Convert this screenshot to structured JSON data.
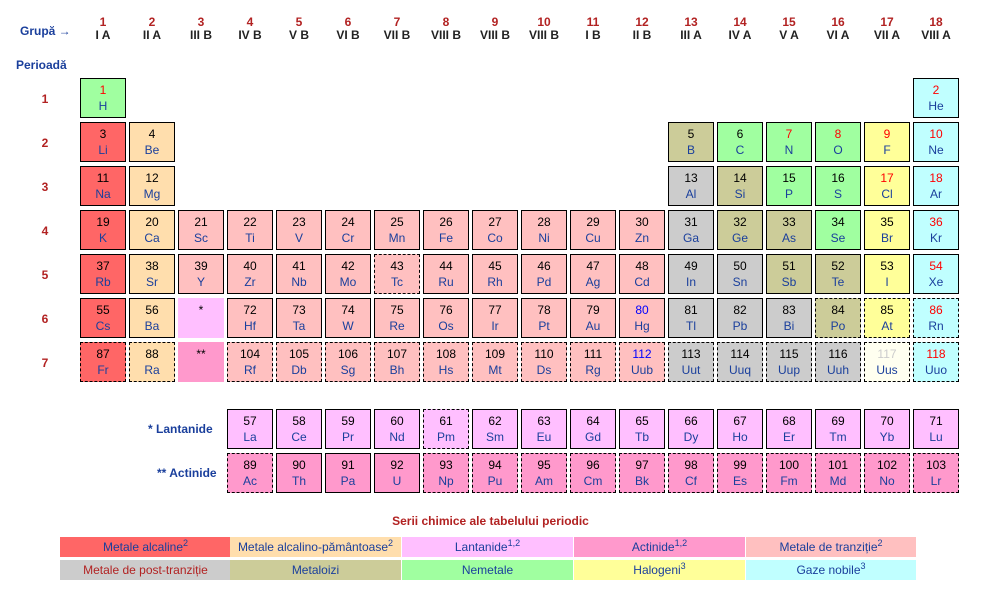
{
  "header": {
    "group_label": "Grupă →",
    "period_label": "Perioadă"
  },
  "groups": [
    {
      "n": "1",
      "r": "I A"
    },
    {
      "n": "2",
      "r": "II A"
    },
    {
      "n": "3",
      "r": "III B"
    },
    {
      "n": "4",
      "r": "IV B"
    },
    {
      "n": "5",
      "r": "V B"
    },
    {
      "n": "6",
      "r": "VI B"
    },
    {
      "n": "7",
      "r": "VII B"
    },
    {
      "n": "8",
      "r": "VIII B"
    },
    {
      "n": "9",
      "r": "VIII B"
    },
    {
      "n": "10",
      "r": "VIII B"
    },
    {
      "n": "11",
      "r": "I B"
    },
    {
      "n": "12",
      "r": "II B"
    },
    {
      "n": "13",
      "r": "III A"
    },
    {
      "n": "14",
      "r": "IV A"
    },
    {
      "n": "15",
      "r": "V A"
    },
    {
      "n": "16",
      "r": "VI A"
    },
    {
      "n": "17",
      "r": "VII A"
    },
    {
      "n": "18",
      "r": "VIII A"
    }
  ],
  "periods": [
    "1",
    "2",
    "3",
    "4",
    "5",
    "6",
    "7"
  ],
  "series_labels": {
    "lanthanides": "* Lantanide",
    "actinides": "** Actinide"
  },
  "colors": {
    "alkali": "#ff6666",
    "alkaline": "#ffdead",
    "lanth": "#ffbfff",
    "actin": "#ff99cc",
    "trans": "#ffc0c0",
    "post": "#cccccc",
    "metalloid": "#cccc99",
    "nonmetal": "#a0ffa0",
    "halogen": "#ffff99",
    "noble": "#c0ffff",
    "unk": "#fffff0",
    "num_red": "#ff0000",
    "num_black": "#000000",
    "num_blue": "#0000ff",
    "num_grey": "#cccccc",
    "sym_blue": "#1a3f9c"
  },
  "elements": [
    {
      "z": "1",
      "s": "H",
      "g": 1,
      "p": 1,
      "c": "nonmetal",
      "n": "red"
    },
    {
      "z": "2",
      "s": "He",
      "g": 18,
      "p": 1,
      "c": "noble",
      "n": "red"
    },
    {
      "z": "3",
      "s": "Li",
      "g": 1,
      "p": 2,
      "c": "alkali",
      "n": "black"
    },
    {
      "z": "4",
      "s": "Be",
      "g": 2,
      "p": 2,
      "c": "alkaline",
      "n": "black"
    },
    {
      "z": "5",
      "s": "B",
      "g": 13,
      "p": 2,
      "c": "metalloid",
      "n": "black"
    },
    {
      "z": "6",
      "s": "C",
      "g": 14,
      "p": 2,
      "c": "nonmetal",
      "n": "black"
    },
    {
      "z": "7",
      "s": "N",
      "g": 15,
      "p": 2,
      "c": "nonmetal",
      "n": "red"
    },
    {
      "z": "8",
      "s": "O",
      "g": 16,
      "p": 2,
      "c": "nonmetal",
      "n": "red"
    },
    {
      "z": "9",
      "s": "F",
      "g": 17,
      "p": 2,
      "c": "halogen",
      "n": "red"
    },
    {
      "z": "10",
      "s": "Ne",
      "g": 18,
      "p": 2,
      "c": "noble",
      "n": "red"
    },
    {
      "z": "11",
      "s": "Na",
      "g": 1,
      "p": 3,
      "c": "alkali",
      "n": "black"
    },
    {
      "z": "12",
      "s": "Mg",
      "g": 2,
      "p": 3,
      "c": "alkaline",
      "n": "black"
    },
    {
      "z": "13",
      "s": "Al",
      "g": 13,
      "p": 3,
      "c": "post",
      "n": "black"
    },
    {
      "z": "14",
      "s": "Si",
      "g": 14,
      "p": 3,
      "c": "metalloid",
      "n": "black"
    },
    {
      "z": "15",
      "s": "P",
      "g": 15,
      "p": 3,
      "c": "nonmetal",
      "n": "black"
    },
    {
      "z": "16",
      "s": "S",
      "g": 16,
      "p": 3,
      "c": "nonmetal",
      "n": "black"
    },
    {
      "z": "17",
      "s": "Cl",
      "g": 17,
      "p": 3,
      "c": "halogen",
      "n": "red"
    },
    {
      "z": "18",
      "s": "Ar",
      "g": 18,
      "p": 3,
      "c": "noble",
      "n": "red"
    },
    {
      "z": "19",
      "s": "K",
      "g": 1,
      "p": 4,
      "c": "alkali",
      "n": "black"
    },
    {
      "z": "20",
      "s": "Ca",
      "g": 2,
      "p": 4,
      "c": "alkaline",
      "n": "black"
    },
    {
      "z": "21",
      "s": "Sc",
      "g": 3,
      "p": 4,
      "c": "trans",
      "n": "black"
    },
    {
      "z": "22",
      "s": "Ti",
      "g": 4,
      "p": 4,
      "c": "trans",
      "n": "black"
    },
    {
      "z": "23",
      "s": "V",
      "g": 5,
      "p": 4,
      "c": "trans",
      "n": "black"
    },
    {
      "z": "24",
      "s": "Cr",
      "g": 6,
      "p": 4,
      "c": "trans",
      "n": "black"
    },
    {
      "z": "25",
      "s": "Mn",
      "g": 7,
      "p": 4,
      "c": "trans",
      "n": "black"
    },
    {
      "z": "26",
      "s": "Fe",
      "g": 8,
      "p": 4,
      "c": "trans",
      "n": "black"
    },
    {
      "z": "27",
      "s": "Co",
      "g": 9,
      "p": 4,
      "c": "trans",
      "n": "black"
    },
    {
      "z": "28",
      "s": "Ni",
      "g": 10,
      "p": 4,
      "c": "trans",
      "n": "black"
    },
    {
      "z": "29",
      "s": "Cu",
      "g": 11,
      "p": 4,
      "c": "trans",
      "n": "black"
    },
    {
      "z": "30",
      "s": "Zn",
      "g": 12,
      "p": 4,
      "c": "trans",
      "n": "black"
    },
    {
      "z": "31",
      "s": "Ga",
      "g": 13,
      "p": 4,
      "c": "post",
      "n": "black"
    },
    {
      "z": "32",
      "s": "Ge",
      "g": 14,
      "p": 4,
      "c": "metalloid",
      "n": "black"
    },
    {
      "z": "33",
      "s": "As",
      "g": 15,
      "p": 4,
      "c": "metalloid",
      "n": "black"
    },
    {
      "z": "34",
      "s": "Se",
      "g": 16,
      "p": 4,
      "c": "nonmetal",
      "n": "black"
    },
    {
      "z": "35",
      "s": "Br",
      "g": 17,
      "p": 4,
      "c": "halogen",
      "n": "black"
    },
    {
      "z": "36",
      "s": "Kr",
      "g": 18,
      "p": 4,
      "c": "noble",
      "n": "red"
    },
    {
      "z": "37",
      "s": "Rb",
      "g": 1,
      "p": 5,
      "c": "alkali",
      "n": "black"
    },
    {
      "z": "38",
      "s": "Sr",
      "g": 2,
      "p": 5,
      "c": "alkaline",
      "n": "black"
    },
    {
      "z": "39",
      "s": "Y",
      "g": 3,
      "p": 5,
      "c": "trans",
      "n": "black"
    },
    {
      "z": "40",
      "s": "Zr",
      "g": 4,
      "p": 5,
      "c": "trans",
      "n": "black"
    },
    {
      "z": "41",
      "s": "Nb",
      "g": 5,
      "p": 5,
      "c": "trans",
      "n": "black"
    },
    {
      "z": "42",
      "s": "Mo",
      "g": 6,
      "p": 5,
      "c": "trans",
      "n": "black"
    },
    {
      "z": "43",
      "s": "Tc",
      "g": 7,
      "p": 5,
      "c": "trans",
      "n": "black",
      "d": 1
    },
    {
      "z": "44",
      "s": "Ru",
      "g": 8,
      "p": 5,
      "c": "trans",
      "n": "black"
    },
    {
      "z": "45",
      "s": "Rh",
      "g": 9,
      "p": 5,
      "c": "trans",
      "n": "black"
    },
    {
      "z": "46",
      "s": "Pd",
      "g": 10,
      "p": 5,
      "c": "trans",
      "n": "black"
    },
    {
      "z": "47",
      "s": "Ag",
      "g": 11,
      "p": 5,
      "c": "trans",
      "n": "black"
    },
    {
      "z": "48",
      "s": "Cd",
      "g": 12,
      "p": 5,
      "c": "trans",
      "n": "black"
    },
    {
      "z": "49",
      "s": "In",
      "g": 13,
      "p": 5,
      "c": "post",
      "n": "black"
    },
    {
      "z": "50",
      "s": "Sn",
      "g": 14,
      "p": 5,
      "c": "post",
      "n": "black"
    },
    {
      "z": "51",
      "s": "Sb",
      "g": 15,
      "p": 5,
      "c": "metalloid",
      "n": "black"
    },
    {
      "z": "52",
      "s": "Te",
      "g": 16,
      "p": 5,
      "c": "metalloid",
      "n": "black"
    },
    {
      "z": "53",
      "s": "I",
      "g": 17,
      "p": 5,
      "c": "halogen",
      "n": "black"
    },
    {
      "z": "54",
      "s": "Xe",
      "g": 18,
      "p": 5,
      "c": "noble",
      "n": "red"
    },
    {
      "z": "55",
      "s": "Cs",
      "g": 1,
      "p": 6,
      "c": "alkali",
      "n": "black"
    },
    {
      "z": "56",
      "s": "Ba",
      "g": 2,
      "p": 6,
      "c": "alkaline",
      "n": "black"
    },
    {
      "z": "*",
      "s": "",
      "g": 3,
      "p": 6,
      "c": "lanth",
      "n": "black",
      "m": 1
    },
    {
      "z": "72",
      "s": "Hf",
      "g": 4,
      "p": 6,
      "c": "trans",
      "n": "black"
    },
    {
      "z": "73",
      "s": "Ta",
      "g": 5,
      "p": 6,
      "c": "trans",
      "n": "black"
    },
    {
      "z": "74",
      "s": "W",
      "g": 6,
      "p": 6,
      "c": "trans",
      "n": "black"
    },
    {
      "z": "75",
      "s": "Re",
      "g": 7,
      "p": 6,
      "c": "trans",
      "n": "black"
    },
    {
      "z": "76",
      "s": "Os",
      "g": 8,
      "p": 6,
      "c": "trans",
      "n": "black"
    },
    {
      "z": "77",
      "s": "Ir",
      "g": 9,
      "p": 6,
      "c": "trans",
      "n": "black"
    },
    {
      "z": "78",
      "s": "Pt",
      "g": 10,
      "p": 6,
      "c": "trans",
      "n": "black"
    },
    {
      "z": "79",
      "s": "Au",
      "g": 11,
      "p": 6,
      "c": "trans",
      "n": "black"
    },
    {
      "z": "80",
      "s": "Hg",
      "g": 12,
      "p": 6,
      "c": "trans",
      "n": "blue"
    },
    {
      "z": "81",
      "s": "Tl",
      "g": 13,
      "p": 6,
      "c": "post",
      "n": "black"
    },
    {
      "z": "82",
      "s": "Pb",
      "g": 14,
      "p": 6,
      "c": "post",
      "n": "black"
    },
    {
      "z": "83",
      "s": "Bi",
      "g": 15,
      "p": 6,
      "c": "post",
      "n": "black"
    },
    {
      "z": "84",
      "s": "Po",
      "g": 16,
      "p": 6,
      "c": "metalloid",
      "n": "black",
      "d": 1
    },
    {
      "z": "85",
      "s": "At",
      "g": 17,
      "p": 6,
      "c": "halogen",
      "n": "black",
      "d": 1
    },
    {
      "z": "86",
      "s": "Rn",
      "g": 18,
      "p": 6,
      "c": "noble",
      "n": "red",
      "d": 1
    },
    {
      "z": "87",
      "s": "Fr",
      "g": 1,
      "p": 7,
      "c": "alkali",
      "n": "black",
      "d": 1
    },
    {
      "z": "88",
      "s": "Ra",
      "g": 2,
      "p": 7,
      "c": "alkaline",
      "n": "black",
      "d": 1
    },
    {
      "z": "**",
      "s": "",
      "g": 3,
      "p": 7,
      "c": "actin",
      "n": "black",
      "m": 1
    },
    {
      "z": "104",
      "s": "Rf",
      "g": 4,
      "p": 7,
      "c": "trans",
      "n": "black",
      "d": 1
    },
    {
      "z": "105",
      "s": "Db",
      "g": 5,
      "p": 7,
      "c": "trans",
      "n": "black",
      "d": 1
    },
    {
      "z": "106",
      "s": "Sg",
      "g": 6,
      "p": 7,
      "c": "trans",
      "n": "black",
      "d": 1
    },
    {
      "z": "107",
      "s": "Bh",
      "g": 7,
      "p": 7,
      "c": "trans",
      "n": "black",
      "d": 1
    },
    {
      "z": "108",
      "s": "Hs",
      "g": 8,
      "p": 7,
      "c": "trans",
      "n": "black",
      "d": 1
    },
    {
      "z": "109",
      "s": "Mt",
      "g": 9,
      "p": 7,
      "c": "trans",
      "n": "black",
      "d": 1
    },
    {
      "z": "110",
      "s": "Ds",
      "g": 10,
      "p": 7,
      "c": "trans",
      "n": "black",
      "d": 1
    },
    {
      "z": "111",
      "s": "Rg",
      "g": 11,
      "p": 7,
      "c": "trans",
      "n": "black",
      "d": 1
    },
    {
      "z": "112",
      "s": "Uub",
      "g": 12,
      "p": 7,
      "c": "trans",
      "n": "blue",
      "d": 1
    },
    {
      "z": "113",
      "s": "Uut",
      "g": 13,
      "p": 7,
      "c": "post",
      "n": "black",
      "d": 1
    },
    {
      "z": "114",
      "s": "Uuq",
      "g": 14,
      "p": 7,
      "c": "post",
      "n": "black",
      "d": 1
    },
    {
      "z": "115",
      "s": "Uup",
      "g": 15,
      "p": 7,
      "c": "post",
      "n": "black",
      "d": 1
    },
    {
      "z": "116",
      "s": "Uuh",
      "g": 16,
      "p": 7,
      "c": "post",
      "n": "black",
      "d": 1
    },
    {
      "z": "117",
      "s": "Uus",
      "g": 17,
      "p": 7,
      "c": "unk",
      "n": "grey",
      "d": 1
    },
    {
      "z": "118",
      "s": "Uuo",
      "g": 18,
      "p": 7,
      "c": "noble",
      "n": "red",
      "d": 1
    }
  ],
  "lanthanides": [
    {
      "z": "57",
      "s": "La"
    },
    {
      "z": "58",
      "s": "Ce"
    },
    {
      "z": "59",
      "s": "Pr"
    },
    {
      "z": "60",
      "s": "Nd"
    },
    {
      "z": "61",
      "s": "Pm",
      "d": 1
    },
    {
      "z": "62",
      "s": "Sm"
    },
    {
      "z": "63",
      "s": "Eu"
    },
    {
      "z": "64",
      "s": "Gd"
    },
    {
      "z": "65",
      "s": "Tb"
    },
    {
      "z": "66",
      "s": "Dy"
    },
    {
      "z": "67",
      "s": "Ho"
    },
    {
      "z": "68",
      "s": "Er"
    },
    {
      "z": "69",
      "s": "Tm"
    },
    {
      "z": "70",
      "s": "Yb"
    },
    {
      "z": "71",
      "s": "Lu"
    }
  ],
  "actinides": [
    {
      "z": "89",
      "s": "Ac",
      "d": 1
    },
    {
      "z": "90",
      "s": "Th"
    },
    {
      "z": "91",
      "s": "Pa"
    },
    {
      "z": "92",
      "s": "U"
    },
    {
      "z": "93",
      "s": "Np",
      "d": 1
    },
    {
      "z": "94",
      "s": "Pu",
      "d": 1
    },
    {
      "z": "95",
      "s": "Am",
      "d": 1
    },
    {
      "z": "96",
      "s": "Cm",
      "d": 1
    },
    {
      "z": "97",
      "s": "Bk",
      "d": 1
    },
    {
      "z": "98",
      "s": "Cf",
      "d": 1
    },
    {
      "z": "99",
      "s": "Es",
      "d": 1
    },
    {
      "z": "100",
      "s": "Fm",
      "d": 1
    },
    {
      "z": "101",
      "s": "Md",
      "d": 1
    },
    {
      "z": "102",
      "s": "No",
      "d": 1
    },
    {
      "z": "103",
      "s": "Lr",
      "d": 1
    }
  ],
  "legend": {
    "title": "Serii chimice ale tabelului periodic",
    "row1": [
      {
        "label": "Metale alcaline",
        "sup": "2",
        "c": "alkali",
        "tc": "#1a3f9c"
      },
      {
        "label": "Metale alcalino-pământoase",
        "sup": "2",
        "c": "alkaline",
        "tc": "#1a3f9c"
      },
      {
        "label": "Lantanide",
        "sup": "1,2",
        "c": "lanth",
        "tc": "#1a3f9c"
      },
      {
        "label": "Actinide",
        "sup": "1,2",
        "c": "actin",
        "tc": "#1a3f9c"
      },
      {
        "label": "Metale de tranziție",
        "sup": "2",
        "c": "trans",
        "tc": "#1a3f9c"
      }
    ],
    "row2": [
      {
        "label": "Metale de post-tranziție",
        "sup": "",
        "c": "post",
        "tc": "#b22222"
      },
      {
        "label": "Metaloizi",
        "sup": "",
        "c": "metalloid",
        "tc": "#1a3f9c"
      },
      {
        "label": "Nemetale",
        "sup": "",
        "c": "nonmetal",
        "tc": "#1a3f9c"
      },
      {
        "label": "Halogeni",
        "sup": "3",
        "c": "halogen",
        "tc": "#1a3f9c"
      },
      {
        "label": "Gaze nobile",
        "sup": "3",
        "c": "noble",
        "tc": "#1a3f9c"
      }
    ]
  }
}
